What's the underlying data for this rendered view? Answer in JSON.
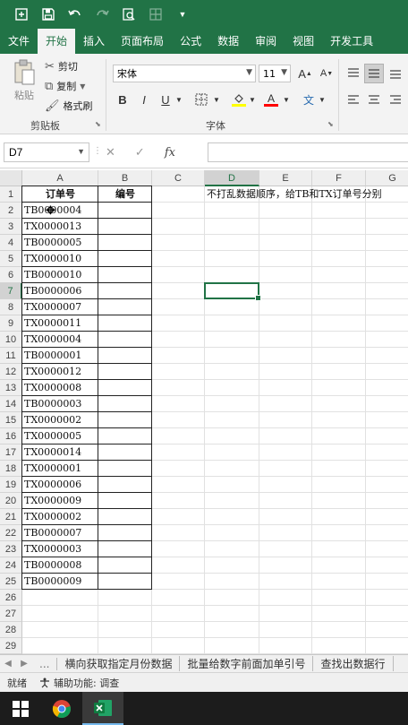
{
  "quick_access": {
    "icons": [
      "autosave-icon",
      "save-icon",
      "undo-icon",
      "redo-icon",
      "print-preview-icon",
      "table-icon",
      "customize-icon"
    ]
  },
  "ribbon_tabs": [
    "文件",
    "开始",
    "插入",
    "页面布局",
    "公式",
    "数据",
    "审阅",
    "视图",
    "开发工具"
  ],
  "active_tab_index": 1,
  "clipboard": {
    "paste_label": "粘贴",
    "cut_label": "剪切",
    "copy_label": "复制",
    "format_painter_label": "格式刷",
    "group_label": "剪贴板"
  },
  "font": {
    "name": "宋体",
    "size": "11",
    "grow": "A",
    "shrink": "A",
    "bold": "B",
    "italic": "I",
    "underline": "U",
    "font_color_letter": "A",
    "group_label": "字体"
  },
  "formula_bar": {
    "name_box": "D7",
    "fx_label": "fx",
    "value": ""
  },
  "grid": {
    "columns": [
      "A",
      "B",
      "C",
      "D",
      "E",
      "F",
      "G"
    ],
    "selected_column": "D",
    "rows": [
      "1",
      "2",
      "3",
      "4",
      "5",
      "6",
      "7",
      "8",
      "9",
      "10",
      "11",
      "12",
      "13",
      "14",
      "15",
      "16",
      "17",
      "18",
      "19",
      "20",
      "21",
      "22",
      "23",
      "24",
      "25",
      "26",
      "27",
      "28",
      "29"
    ],
    "selected_row": "7",
    "header_a": "订单号",
    "header_b": "编号",
    "instruction": "不打乱数据顺序，给TB和TX订单号分别",
    "orders": [
      "TB0000004",
      "TX0000013",
      "TB0000005",
      "TX0000010",
      "TB0000010",
      "TB0000006",
      "TX0000007",
      "TX0000011",
      "TX0000004",
      "TB0000001",
      "TX0000012",
      "TX0000008",
      "TB0000003",
      "TX0000002",
      "TX0000005",
      "TX0000014",
      "TX0000001",
      "TX0000006",
      "TX0000009",
      "TX0000002",
      "TB0000007",
      "TX0000003",
      "TB0000008",
      "TB0000009"
    ]
  },
  "sheet_tabs": {
    "more": "...",
    "tabs": [
      "横向获取指定月份数据",
      "批量给数字前面加单引号",
      "查找出数据行"
    ]
  },
  "status": {
    "ready": "就绪",
    "accessibility": "辅助功能: 调查"
  },
  "colors": {
    "excel_green": "#217346",
    "taskbar": "#1c1c1c"
  }
}
